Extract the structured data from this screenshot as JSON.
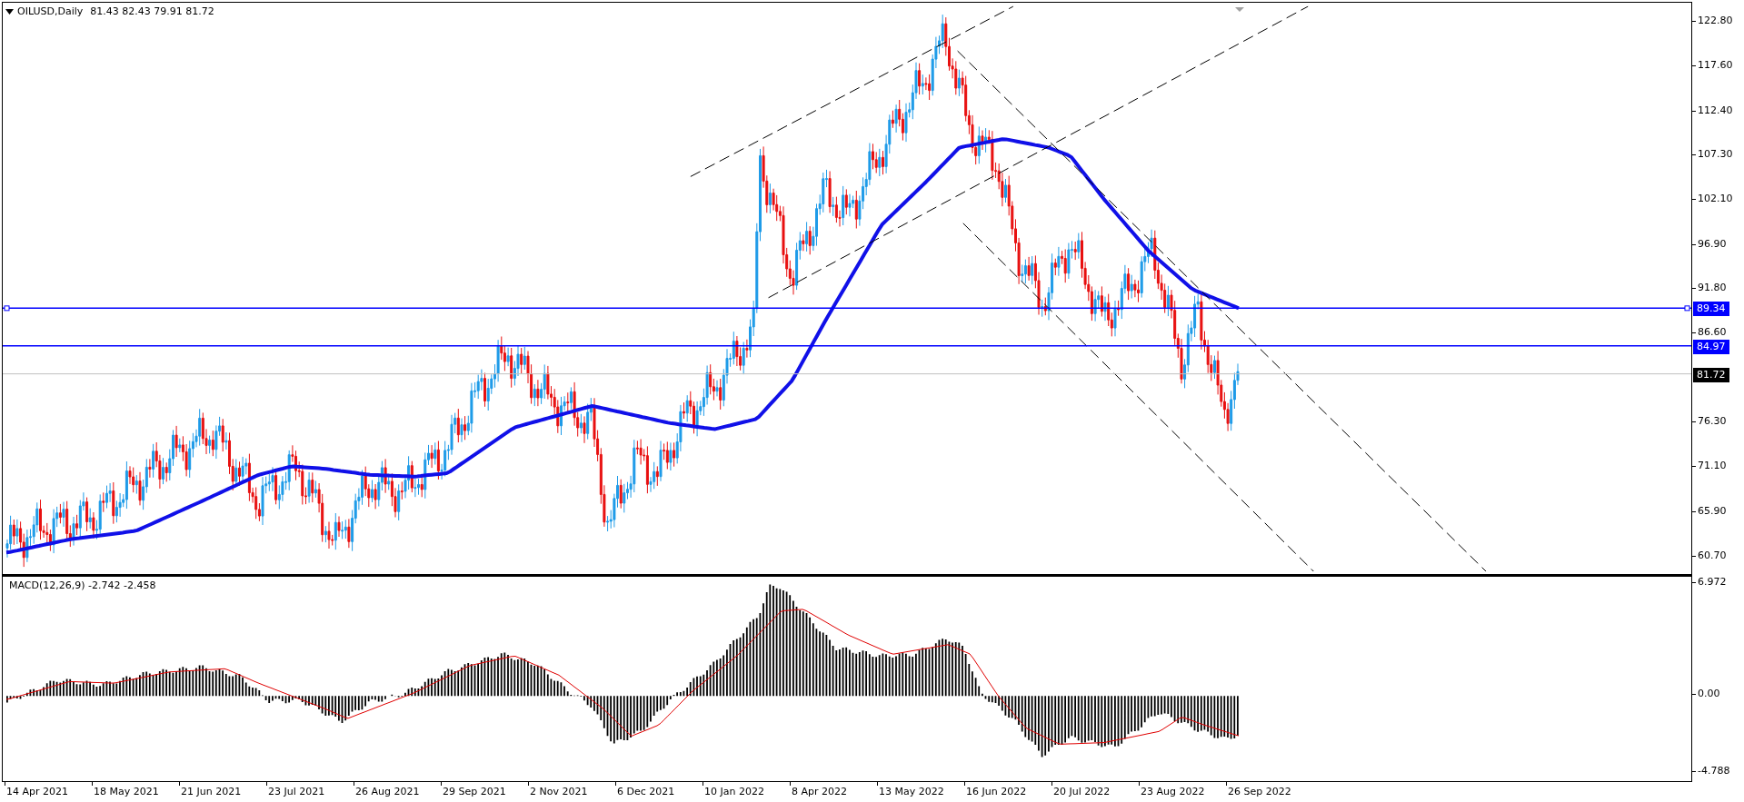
{
  "price_pane": {
    "legend": {
      "symbol": "OILUSD,Daily",
      "values": "81.43 82.43 79.91 81.72"
    },
    "axis": [
      "122.80",
      "117.60",
      "112.40",
      "107.30",
      "102.10",
      "96.90",
      "91.80",
      "86.60",
      "76.30",
      "71.10",
      "65.90",
      "60.70"
    ],
    "price_lines": [
      {
        "label": "89.34",
        "kind": "level"
      },
      {
        "label": "84.97",
        "kind": "level"
      },
      {
        "label": "81.72",
        "kind": "bid"
      }
    ]
  },
  "macd_pane": {
    "legend": "MACD(12,26,9) -2.742 -2.458",
    "axis": [
      "6.972",
      "0.00",
      "-4.788"
    ]
  },
  "date_axis": [
    "14 Apr 2021",
    "18 May 2021",
    "21 Jun 2021",
    "23 Jul 2021",
    "26 Aug 2021",
    "29 Sep 2021",
    "2 Nov 2021",
    "6 Dec 2021",
    "10 Jan 2022",
    "8 Apr 2022",
    "13 May 2022",
    "16 Jun 2022",
    "20 Jul 2022",
    "23 Aug 2022",
    "26 Sep 2022"
  ]
}
